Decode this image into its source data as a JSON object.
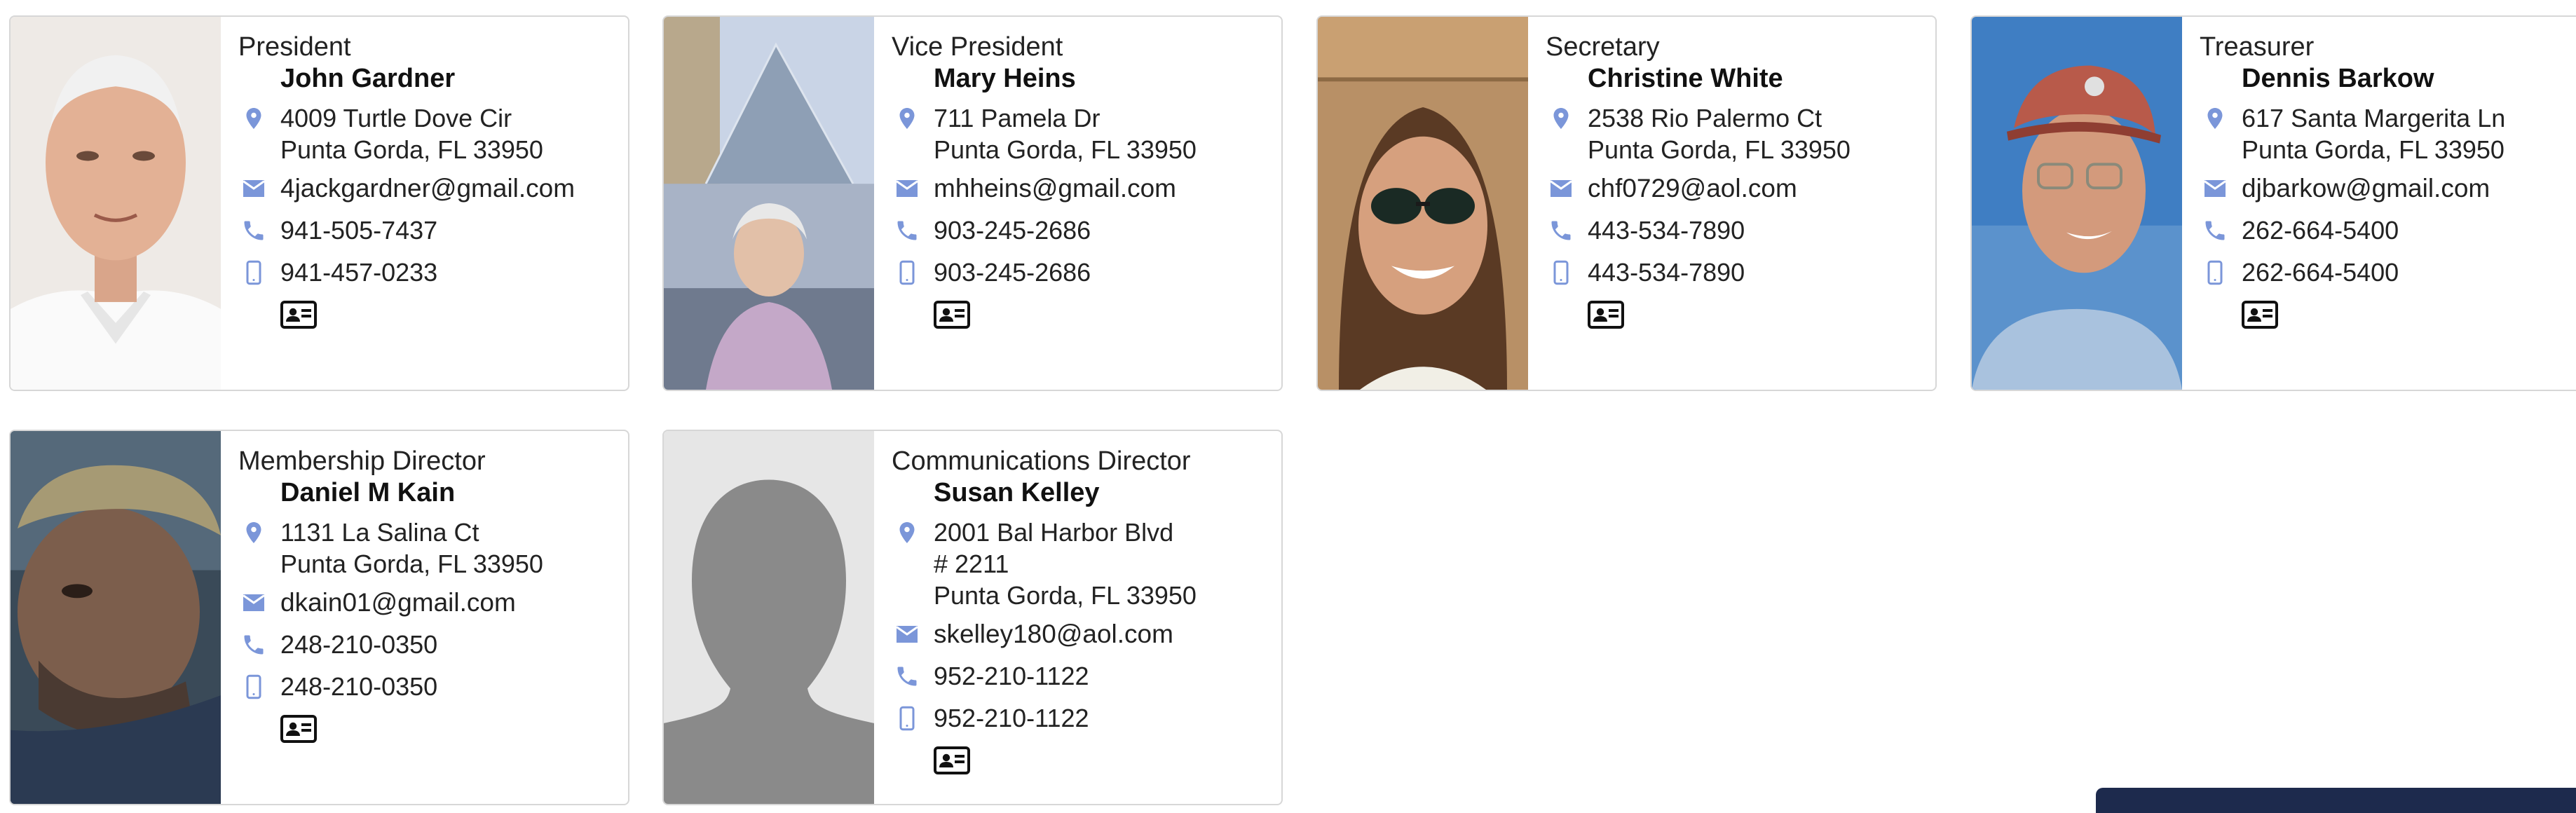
{
  "colors": {
    "icon_accent": "#7b96d9",
    "bar": "#1d2a4d"
  },
  "cards": [
    {
      "role": "President",
      "name": "John Gardner",
      "address_line1": "4009 Turtle Dove Cir",
      "address_line2": "Punta Gorda, FL 33950",
      "email": "4jackgardner@gmail.com",
      "phone": "941-505-7437",
      "mobile": "941-457-0233"
    },
    {
      "role": "Vice President",
      "name": "Mary Heins",
      "address_line1": "711 Pamela Dr",
      "address_line2": "Punta Gorda, FL 33950",
      "email": "mhheins@gmail.com",
      "phone": "903-245-2686",
      "mobile": "903-245-2686"
    },
    {
      "role": "Secretary",
      "name": "Christine White",
      "address_line1": "2538 Rio Palermo Ct",
      "address_line2": "Punta Gorda, FL 33950",
      "email": "chf0729@aol.com",
      "phone": "443-534-7890",
      "mobile": "443-534-7890"
    },
    {
      "role": "Treasurer",
      "name": "Dennis Barkow",
      "address_line1": "617 Santa Margerita Ln",
      "address_line2": "Punta Gorda, FL 33950",
      "email": "djbarkow@gmail.com",
      "phone": "262-664-5400",
      "mobile": "262-664-5400"
    },
    {
      "role": "Membership Director",
      "name": "Daniel M Kain",
      "address_line1": "1131 La Salina Ct",
      "address_line2": "Punta Gorda, FL 33950",
      "email": "dkain01@gmail.com",
      "phone": "248-210-0350",
      "mobile": "248-210-0350"
    },
    {
      "role": "Communications Director",
      "name": "Susan Kelley",
      "address_line1": "2001 Bal Harbor Blvd",
      "address_line1b": "# 2211",
      "address_line2": "Punta Gorda, FL 33950",
      "email": "skelley180@aol.com",
      "phone": "952-210-1122",
      "mobile": "952-210-1122"
    }
  ],
  "icons": {
    "address": "map-pin-icon",
    "email": "envelope-icon",
    "phone": "phone-icon",
    "mobile": "mobile-phone-icon",
    "vcard": "contact-card-icon",
    "placeholder": "person-silhouette-icon"
  }
}
